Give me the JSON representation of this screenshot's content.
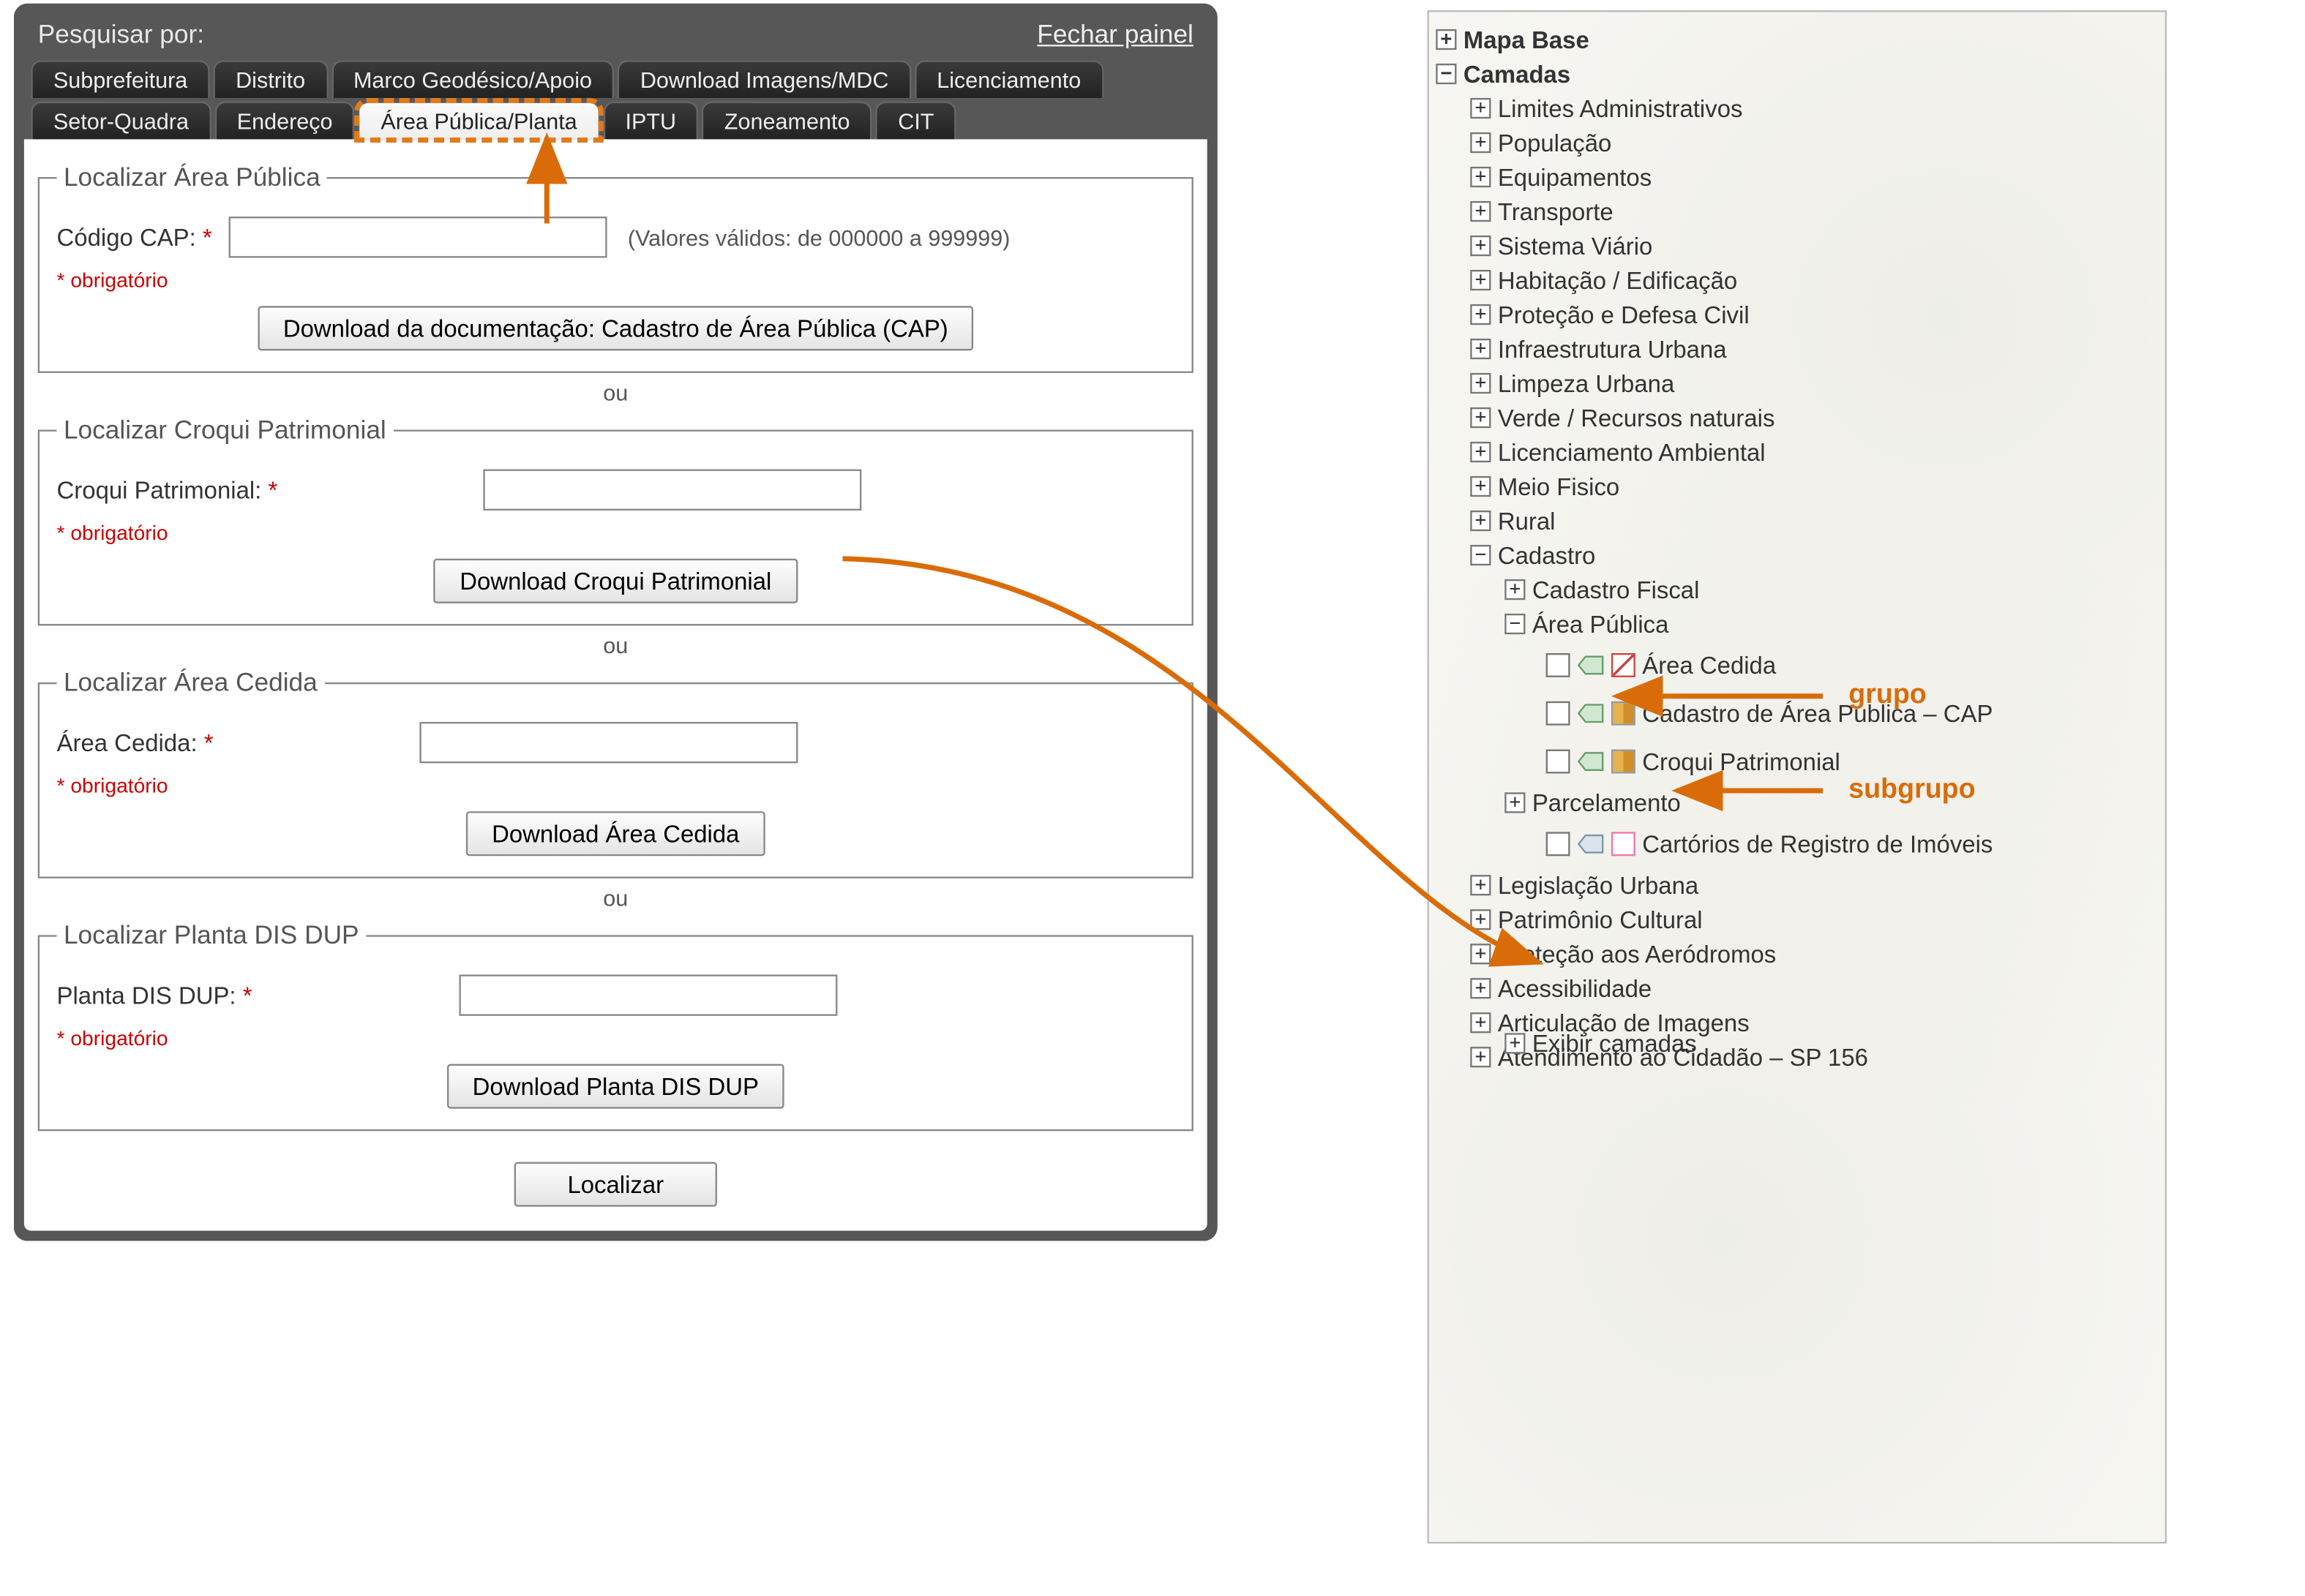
{
  "panel": {
    "search_label": "Pesquisar por:",
    "close_label": "Fechar painel",
    "tabs_row1": [
      "Subprefeitura",
      "Distrito",
      "Marco Geodésico/Apoio",
      "Download Imagens/MDC",
      "Licenciamento"
    ],
    "tabs_row2": [
      "Setor-Quadra",
      "Endereço",
      "Área Pública/Planta",
      "IPTU",
      "Zoneamento",
      "CIT"
    ],
    "active_tab": "Área Pública/Planta",
    "fieldsets": {
      "cap": {
        "legend": "Localizar Área Pública",
        "label": "Código CAP:",
        "hint": "(Valores válidos: de 000000 a 999999)",
        "oblig": "* obrigatório",
        "button": "Download da documentação: Cadastro de Área Pública (CAP)"
      },
      "croqui": {
        "legend": "Localizar Croqui Patrimonial",
        "label": "Croqui Patrimonial:",
        "oblig": "* obrigatório",
        "button": "Download Croqui Patrimonial"
      },
      "cedida": {
        "legend": "Localizar Área Cedida",
        "label": "Área Cedida:",
        "oblig": "* obrigatório",
        "button": "Download Área Cedida"
      },
      "disdup": {
        "legend": "Localizar Planta DIS DUP",
        "label": "Planta DIS DUP:",
        "oblig": "* obrigatório",
        "button": "Download Planta DIS DUP"
      }
    },
    "or_label": "ou",
    "locate_button": "Localizar"
  },
  "layers": {
    "root1": "Mapa Base",
    "root2": "Camadas",
    "items": [
      "Limites Administrativos",
      "População",
      "Equipamentos",
      "Transporte",
      "Sistema Viário",
      "Habitação / Edificação",
      "Proteção e Defesa Civil",
      "Infraestrutura Urbana",
      "Limpeza Urbana",
      "Verde / Recursos naturais",
      "Licenciamento Ambiental",
      "Meio Fisico",
      "Rural"
    ],
    "cadastro": "Cadastro",
    "cadastro_children": {
      "fiscal": "Cadastro Fiscal",
      "area_publica": "Área Pública",
      "area_publica_layers": [
        "Área Cedida",
        "Cadastro de Área Publica – CAP",
        "Croqui Patrimonial"
      ],
      "parcelamento": "Parcelamento",
      "parcelamento_layer": "Cartórios de Registro de Imóveis"
    },
    "items_after": [
      "Legislação Urbana",
      "Patrimônio Cultural",
      "Proteção aos Aeródromos",
      "Acessibilidade",
      "Articulação de Imagens",
      "Atendimento ao Cidadão – SP 156"
    ],
    "show_layers": "Exibir camadas"
  },
  "annotations": {
    "grupo": "grupo",
    "subgrupo": "subgrupo"
  }
}
